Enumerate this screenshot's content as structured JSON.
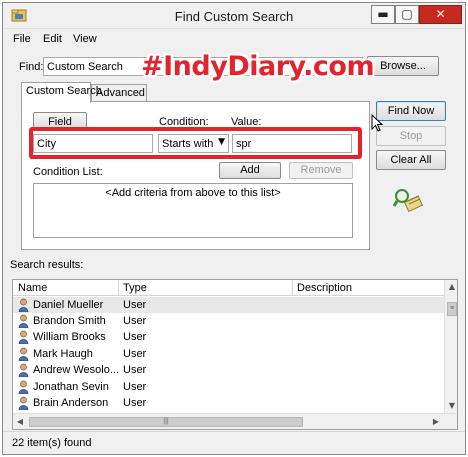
{
  "window": {
    "title": "Find Custom Search"
  },
  "titlebar_buttons": {
    "minimize": "▬",
    "maximize": "▢",
    "close": "✕"
  },
  "menu": [
    "File",
    "Edit",
    "View"
  ],
  "find": {
    "label": "Find:",
    "value": "Custom Search",
    "browse_label": "Browse..."
  },
  "watermark": "#IndyDiary.com",
  "tabs": [
    "Custom Search",
    "Advanced"
  ],
  "criteria": {
    "field_button": "Field",
    "field_value": "City",
    "condition_label": "Condition:",
    "condition_value": "Starts with",
    "value_label": "Value:",
    "value_value": "spr",
    "list_label": "Condition List:",
    "add_label": "Add",
    "remove_label": "Remove",
    "list_placeholder": "<Add criteria from above to this list>"
  },
  "actions": {
    "find_now": "Find Now",
    "stop": "Stop",
    "clear_all": "Clear All"
  },
  "results": {
    "label": "Search results:",
    "columns": [
      "Name",
      "Type",
      "Description"
    ],
    "rows": [
      {
        "name": "Daniel Mueller",
        "type": "User"
      },
      {
        "name": "Brandon Smith",
        "type": "User"
      },
      {
        "name": "William Brooks",
        "type": "User"
      },
      {
        "name": "Mark Haugh",
        "type": "User"
      },
      {
        "name": "Andrew Wesolo...",
        "type": "User"
      },
      {
        "name": "Jonathan Sevin",
        "type": "User"
      },
      {
        "name": "Brain Anderson",
        "type": "User"
      }
    ]
  },
  "status": "22 item(s) found",
  "colors": {
    "accent_red": "#e4242c",
    "close_red": "#c7291f"
  },
  "icons": [
    "app-icon",
    "user-icon",
    "search-animation-icon",
    "mouse-cursor-icon",
    "scroll-arrow-icon"
  ]
}
